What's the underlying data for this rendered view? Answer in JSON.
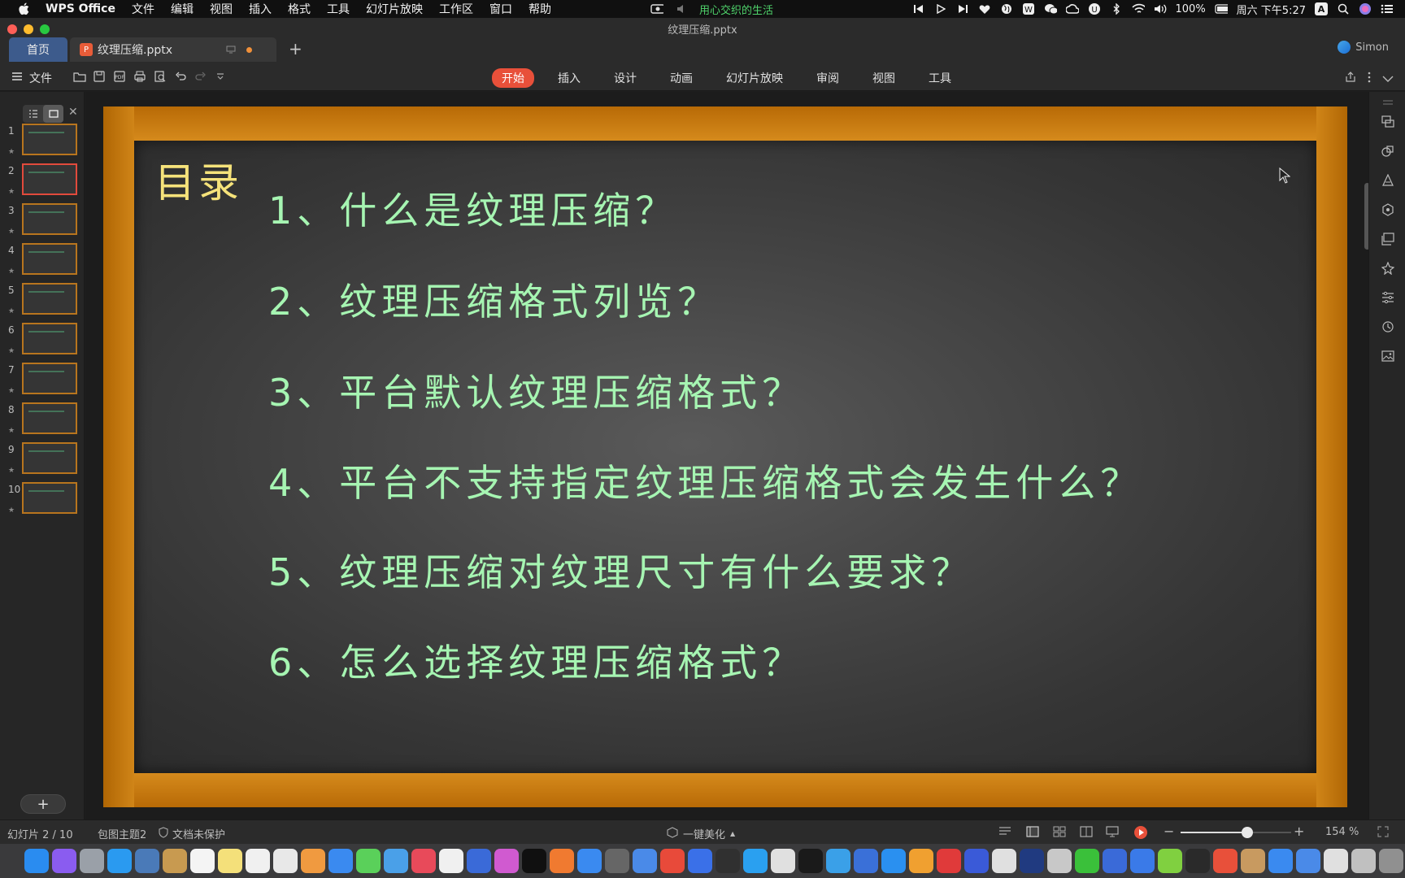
{
  "menubar": {
    "app_name": "WPS Office",
    "menus": [
      "文件",
      "编辑",
      "视图",
      "插入",
      "格式",
      "工具",
      "幻灯片放映",
      "工作区",
      "窗口",
      "帮助"
    ],
    "now_playing": "用心交织的生活",
    "battery": "100%",
    "clock": "周六 下午5:27",
    "input_source": "A"
  },
  "window": {
    "title": "纹理压缩.pptx",
    "tabs": {
      "home": "首页",
      "file": "纹理压缩.pptx"
    },
    "user": "Simon"
  },
  "toolbar": {
    "file_label": "文件",
    "ribbon_tabs": [
      "开始",
      "插入",
      "设计",
      "动画",
      "幻灯片放映",
      "审阅",
      "视图",
      "工具"
    ],
    "active_tab": "开始"
  },
  "slides_panel": {
    "count": 10,
    "current": 2,
    "numbers": [
      "1",
      "2",
      "3",
      "4",
      "5",
      "6",
      "7",
      "8",
      "9",
      "10"
    ],
    "add_label": "+"
  },
  "slide": {
    "title": "目录",
    "items": [
      "1、什么是纹理压缩？",
      "2、纹理压缩格式列览？",
      "3、平台默认纹理压缩格式？",
      "4、平台不支持指定纹理压缩格式会发生什么？",
      "5、纹理压缩对纹理尺寸有什么要求？",
      "6、怎么选择纹理压缩格式？"
    ],
    "colors": {
      "title": "#f5e27a",
      "items": "#a6f5b2",
      "frame": "#c77a10",
      "board": "#474747"
    }
  },
  "statusbar": {
    "slide_indicator": "幻灯片 2 / 10",
    "theme": "包图主题2",
    "protection": "文档未保护",
    "beautify": "一键美化",
    "zoom": "154 %",
    "zoom_level": 0.6
  },
  "colors": {
    "accent": "#e8503a",
    "home_tab": "#3d5b8c"
  }
}
